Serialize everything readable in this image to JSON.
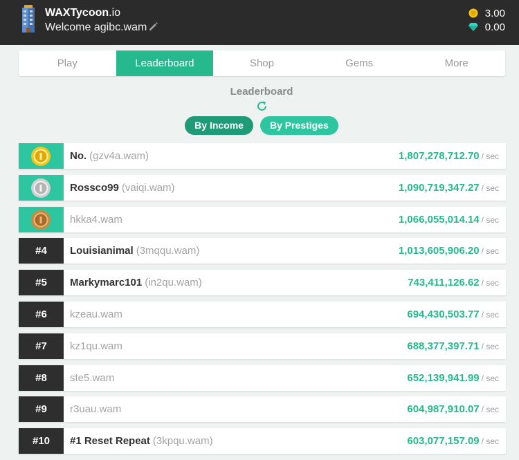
{
  "header": {
    "brand_bold": "WAXTycoon",
    "brand_suffix": ".io",
    "welcome": "Welcome agibc.wam",
    "gold_balance": "3.00",
    "gem_balance": "0.00",
    "icons": {
      "logo": "building-icon",
      "edit": "pencil-icon",
      "gold": "gold-coin-icon",
      "gem": "diamond-icon"
    }
  },
  "tabs": [
    {
      "label": "Play",
      "active": false
    },
    {
      "label": "Leaderboard",
      "active": true
    },
    {
      "label": "Shop",
      "active": false
    },
    {
      "label": "Gems",
      "active": false
    },
    {
      "label": "More",
      "active": false
    }
  ],
  "leaderboard": {
    "title": "Leaderboard",
    "filters": {
      "by_income": "By Income",
      "by_prestiges": "By Prestiges"
    },
    "unit": "/ sec",
    "rows": [
      {
        "rank": "",
        "medal": "gold",
        "nickname": "No.",
        "account": "(gzv4a.wam)",
        "income": "1,807,278,712.70"
      },
      {
        "rank": "",
        "medal": "silver",
        "nickname": "Rossco99",
        "account": "(vaiqi.wam)",
        "income": "1,090,719,347.27"
      },
      {
        "rank": "",
        "medal": "bronze",
        "nickname": "",
        "account": "hkka4.wam",
        "income": "1,066,055,014.14"
      },
      {
        "rank": "#4",
        "medal": "",
        "nickname": "Louisianimal",
        "account": "(3mqqu.wam)",
        "income": "1,013,605,906.20"
      },
      {
        "rank": "#5",
        "medal": "",
        "nickname": "Markymarc101",
        "account": "(in2qu.wam)",
        "income": "743,411,126.62"
      },
      {
        "rank": "#6",
        "medal": "",
        "nickname": "",
        "account": "kzeau.wam",
        "income": "694,430,503.77"
      },
      {
        "rank": "#7",
        "medal": "",
        "nickname": "",
        "account": "kz1qu.wam",
        "income": "688,377,397.71"
      },
      {
        "rank": "#8",
        "medal": "",
        "nickname": "",
        "account": "ste5.wam",
        "income": "652,139,941.99"
      },
      {
        "rank": "#9",
        "medal": "",
        "nickname": "",
        "account": "r3uau.wam",
        "income": "604,987,910.07"
      },
      {
        "rank": "#10",
        "medal": "",
        "nickname": "#1 Reset Repeat",
        "account": "(3kpqu.wam)",
        "income": "603,077,157.09"
      }
    ]
  },
  "colors": {
    "accent": "#26b98d",
    "accent_dark": "#1f9c77",
    "topbar": "#2b2b2b",
    "gold": "#f5c518",
    "silver": "#cfcfcf",
    "bronze": "#c98a3b"
  }
}
